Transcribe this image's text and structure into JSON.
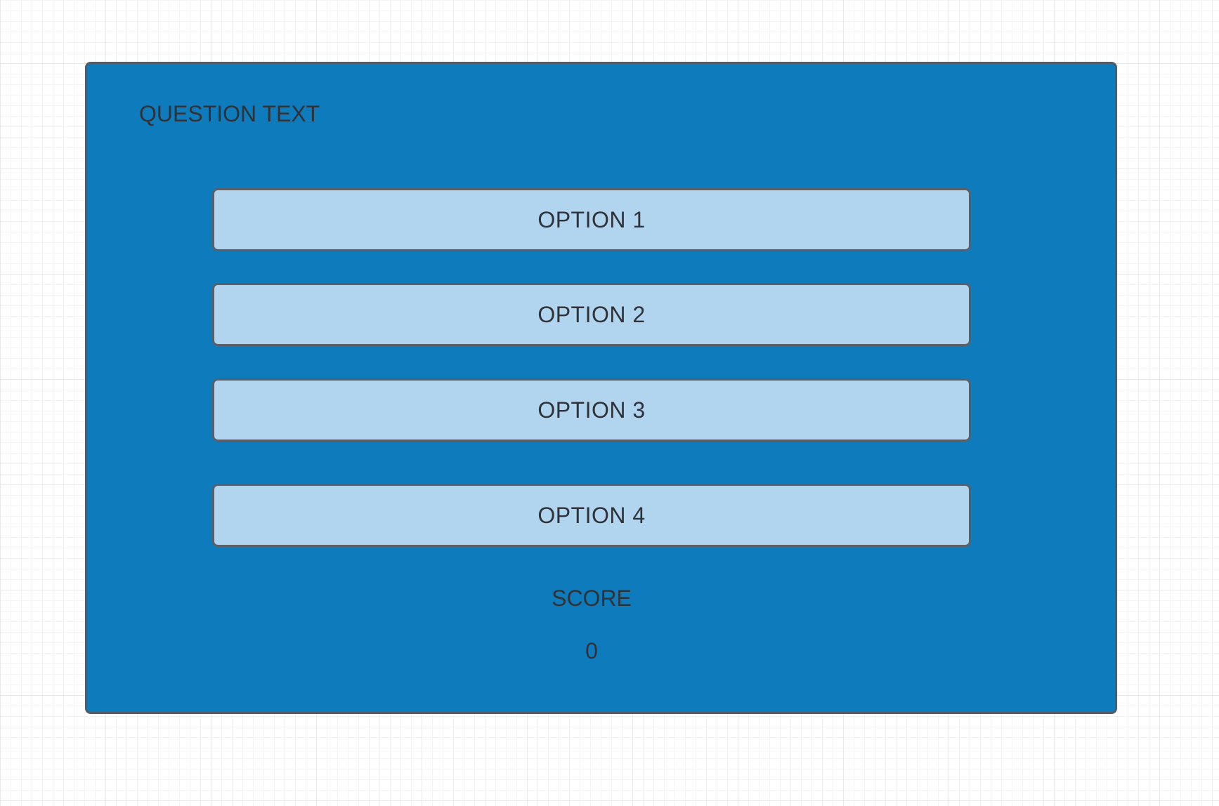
{
  "colors": {
    "panel_fill": "#0e7bbd",
    "panel_border": "#545b66",
    "option_fill": "#b2d5ef",
    "option_border": "#5b6068",
    "text": "#2f3238"
  },
  "quiz": {
    "question_text": "QUESTION TEXT",
    "options": [
      {
        "label": "OPTION 1"
      },
      {
        "label": "OPTION 2"
      },
      {
        "label": "OPTION 3"
      },
      {
        "label": "OPTION 4"
      }
    ],
    "score_label": "SCORE",
    "score_value": "0"
  }
}
